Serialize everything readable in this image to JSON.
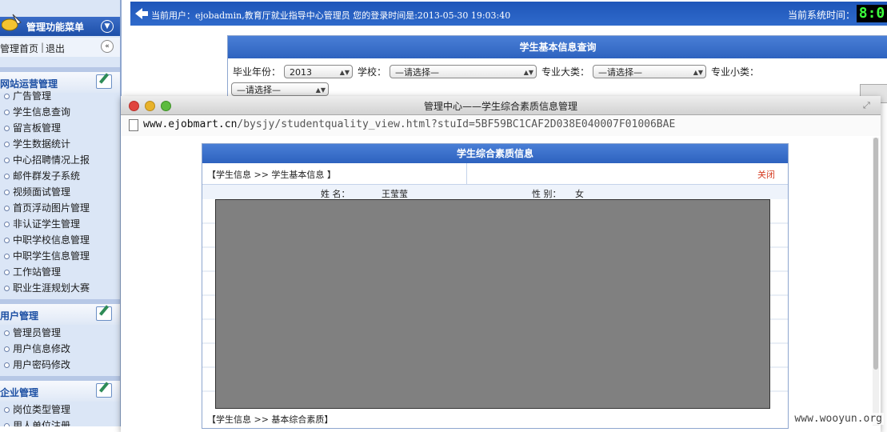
{
  "sidebar": {
    "menu_title": "管理功能菜单",
    "home_link": "管理首页",
    "separator": "|",
    "logout_link": "退出",
    "groups": [
      {
        "title": "网站运营管理",
        "items": [
          "广告管理",
          "学生信息查询",
          "留言板管理",
          "学生数据统计",
          "中心招聘情况上报",
          "邮件群发子系统",
          "视频面试管理",
          "首页浮动图片管理",
          "非认证学生管理",
          "中职学校信息管理",
          "中职学生信息管理",
          "工作站管理",
          "职业生涯规划大赛"
        ]
      },
      {
        "title": "用户管理",
        "items": [
          "管理员管理",
          "用户信息修改",
          "用户密码修改"
        ]
      },
      {
        "title": "企业管理",
        "items": [
          "岗位类型管理",
          "用人单位注册"
        ]
      }
    ]
  },
  "topbar": {
    "user_info": "当前用户：ejobadmin,教育厅就业指导中心管理员 您的登录时间是:2013-05-30 19:03:40",
    "system_time_label": "当前系统时间：",
    "clock": "8:0"
  },
  "query": {
    "title": "学生基本信息查询",
    "year_label": "毕业年份：",
    "year_value": "2013",
    "school_label": "学校：",
    "school_value": "—请选择—",
    "major_big_label": "专业大类：",
    "major_big_value": "—请选择—",
    "major_small_label": "专业小类：",
    "major_small_value": "—请选择—"
  },
  "popup": {
    "window_title": "管理中心——学生综合素质信息管理",
    "url_host": "www.ejobmart.cn",
    "url_path": "/bysjy/studentquality_view.html?stuId=5BF59BC1CAF2D038E040007F01006BAE",
    "panel_title": "学生综合素质信息",
    "breadcrumb": "【学生信息 >> 学生基本信息 】",
    "close_label": "关闭",
    "name_label": "姓 名：",
    "name_value": "王莹莹",
    "gender_label": "性 别：",
    "gender_value": "女",
    "breadcrumb2": "【学生信息 >> 基本综合素质】"
  },
  "watermark": "www.wooyun.org"
}
